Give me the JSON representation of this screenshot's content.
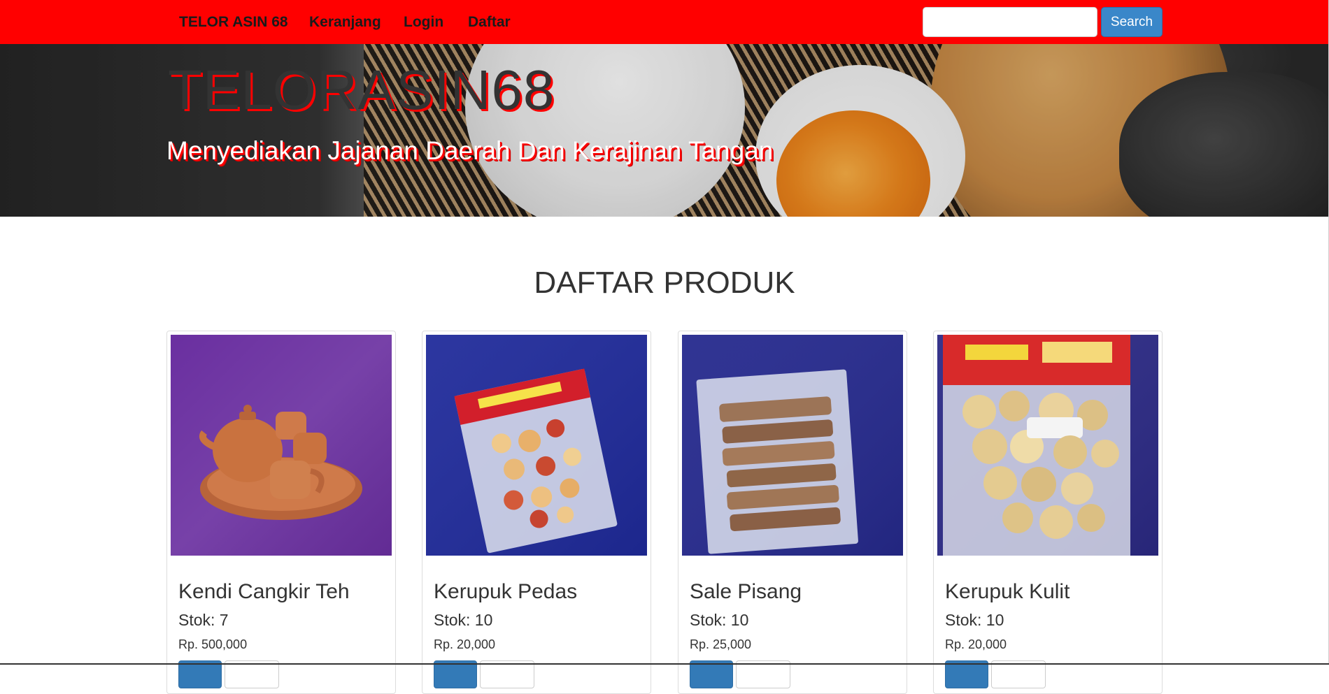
{
  "navbar": {
    "brand": "TELOR ASIN 68",
    "links": [
      "Keranjang",
      "Login",
      "Daftar"
    ],
    "search_placeholder": "",
    "search_button": "Search",
    "color": "#ff0000"
  },
  "hero": {
    "title": "TELORASIN68",
    "tagline": "Menyediakan Jajanan Daerah Dan Kerajinan Tangan"
  },
  "section": {
    "title": "DAFTAR PRODUK"
  },
  "products": [
    {
      "name": "Kendi Cangkir Teh",
      "stock": "Stok: 7",
      "price": "Rp. 500,000",
      "image": "clay-tea-set-image",
      "bg": "#6a2fa0"
    },
    {
      "name": "Kerupuk Pedas",
      "stock": "Stok: 10",
      "price": "Rp. 20,000",
      "image": "spicy-cracker-pack-image",
      "bg": "#1f2a9a"
    },
    {
      "name": "Sale Pisang",
      "stock": "Stok: 10",
      "price": "Rp. 25,000",
      "image": "banana-sale-pack-image",
      "bg": "#262a8e"
    },
    {
      "name": "Kerupuk Kulit",
      "stock": "Stok: 10",
      "price": "Rp. 20,000",
      "image": "skin-cracker-pack-image",
      "bg": "#2c2a86"
    }
  ],
  "colors": {
    "accent": "#ff0000",
    "button_primary": "#337ab7",
    "search_button": "#3a87c9"
  }
}
